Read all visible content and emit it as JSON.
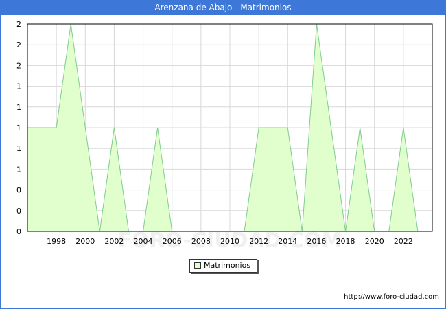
{
  "title": "Arenzana de Abajo - Matrimonios",
  "watermark": "FORO-CIUDAD.COM",
  "source_url": "http://www.foro-ciudad.com",
  "colors": {
    "titlebar": "#3d78d8",
    "fill": "#e0ffcc",
    "line": "#7fcc8e",
    "grid": "#d8d8d8"
  },
  "chart_data": {
    "type": "area",
    "title": "Arenzana de Abajo - Matrimonios",
    "legend": [
      "Matrimonios"
    ],
    "legend_position": "bottom",
    "grid": true,
    "xlim": [
      1996,
      2024
    ],
    "ylim": [
      0,
      2
    ],
    "x_ticks": [
      1998,
      2000,
      2002,
      2004,
      2006,
      2008,
      2010,
      2012,
      2014,
      2016,
      2018,
      2020,
      2022
    ],
    "y_tick_labels": [
      "0",
      "0",
      "0",
      "1",
      "1",
      "1",
      "1",
      "1",
      "2",
      "2",
      "2"
    ],
    "series": [
      {
        "name": "Matrimonios",
        "x": [
          1996,
          1997,
          1998,
          1999,
          2000,
          2001,
          2002,
          2003,
          2004,
          2005,
          2006,
          2007,
          2008,
          2009,
          2010,
          2011,
          2012,
          2013,
          2014,
          2015,
          2016,
          2017,
          2018,
          2019,
          2020,
          2021,
          2022,
          2023
        ],
        "values": [
          1,
          1,
          1,
          2,
          1,
          0,
          1,
          0,
          0,
          1,
          0,
          0,
          0,
          0,
          0,
          0,
          1,
          1,
          1,
          0,
          2,
          1,
          0,
          1,
          0,
          0,
          1,
          0
        ]
      }
    ]
  }
}
